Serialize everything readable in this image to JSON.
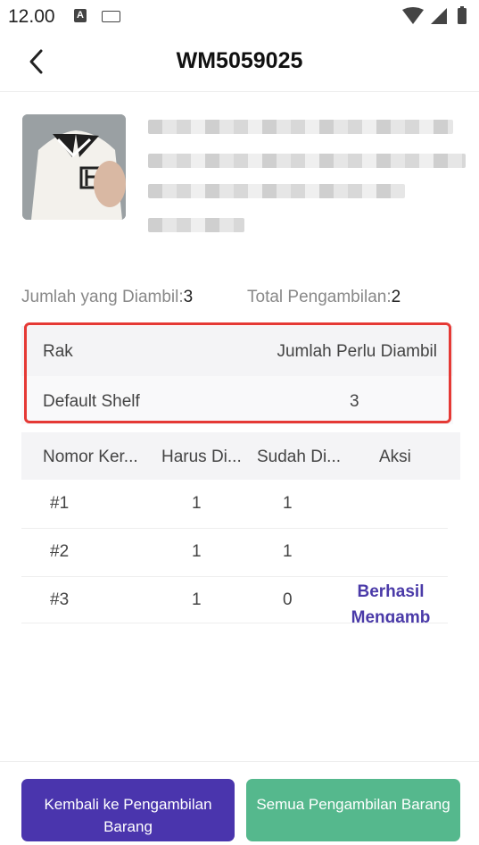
{
  "status": {
    "time": "12.00"
  },
  "header": {
    "title": "WM5059025"
  },
  "summary": {
    "picked_label": "Jumlah yang Diambil:",
    "picked_value": "3",
    "total_label": "Total Pengambilan:",
    "total_value": "2"
  },
  "shelf_table": {
    "col_rack": "Rak",
    "col_qty": "Jumlah Perlu Diambil",
    "rows": [
      {
        "rack": "Default Shelf",
        "qty": "3"
      }
    ]
  },
  "box_table": {
    "headers": [
      "Nomor Ker...",
      "Harus Di...",
      "Sudah Di...",
      "Aksi"
    ],
    "rows": [
      {
        "no": "#1",
        "must": "1",
        "done": "1",
        "action": ""
      },
      {
        "no": "#2",
        "must": "1",
        "done": "1",
        "action": ""
      },
      {
        "no": "#3",
        "must": "1",
        "done": "0",
        "action": "Berhasil Mengamb"
      }
    ]
  },
  "footer": {
    "back_label": "Kembali ke Pengambilan Barang",
    "all_label": "Semua Pengambilan Barang"
  },
  "colors": {
    "primary": "#4a35ad",
    "success": "#55b88d",
    "highlight": "#e53935",
    "link": "#4a3aa8"
  }
}
